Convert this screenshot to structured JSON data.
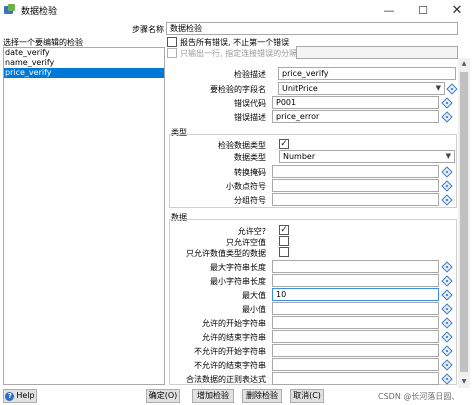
{
  "window": {
    "title": "数据检验",
    "minimize": "—",
    "maximize": "☐",
    "close": "✕"
  },
  "header": {
    "step_name_label": "步骤名称",
    "step_name_value": "数据检验",
    "report_all_label": "报告所有错误, 不止第一个错误",
    "output_one_row_label": "只输出一行, 指定连接错误的分隔符:"
  },
  "list": {
    "label": "选择一个要编辑的检验",
    "items": [
      {
        "label": "date_verify",
        "selected": false
      },
      {
        "label": "name_verify",
        "selected": false
      },
      {
        "label": "price_verify",
        "selected": true
      }
    ]
  },
  "top_fields": {
    "description_label": "检验描述",
    "description_value": "price_verify",
    "field_label": "要检验的字段名",
    "field_value": "UnitPrice",
    "error_code_label": "错误代码",
    "error_code_value": "P001",
    "error_desc_label": "错误描述",
    "error_desc_value": "price_error"
  },
  "type_group": {
    "title": "类型",
    "check_type_label": "检验数据类型",
    "check_type_checked": true,
    "data_type_label": "数据类型",
    "data_type_value": "Number",
    "conversion_mask_label": "转换掩码",
    "decimal_symbol_label": "小数点符号",
    "grouping_symbol_label": "分组符号"
  },
  "data_group": {
    "title": "数据",
    "allow_null_label": "允许空?",
    "allow_null_checked": true,
    "only_null_label": "只允许空值",
    "only_null_checked": false,
    "only_numeric_label": "只允许数值类型的数据",
    "only_numeric_checked": false,
    "max_len_label": "最大字符串长度",
    "min_len_label": "最小字符串长度",
    "max_value_label": "最大值",
    "max_value_value": "10",
    "min_value_label": "最小值",
    "allowed_start_label": "允许的开始字符串",
    "allowed_end_label": "允许的结束字符串",
    "disallowed_start_label": "不允许的开始字符串",
    "disallowed_end_label": "不允许的结束字符串",
    "regex_label": "合法数据的正则表达式"
  },
  "buttons": {
    "help": "Help",
    "ok": "确定(O)",
    "add": "增加检验",
    "delete": "删除检验",
    "cancel": "取消(C)"
  },
  "watermark": "CSDN @长河落日圆、",
  "icons": [
    "app-icon",
    "variable-diamond-icon",
    "chevron-down-icon",
    "help-icon"
  ]
}
